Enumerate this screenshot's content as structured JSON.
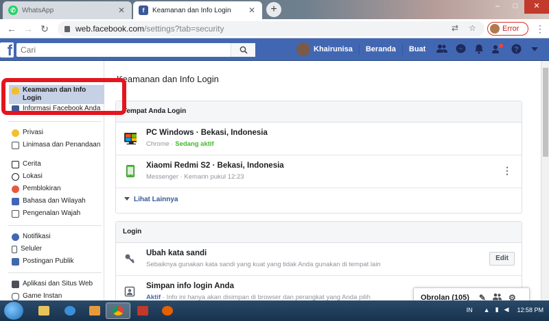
{
  "browser": {
    "tabs": [
      {
        "label": "WhatsApp",
        "active": false
      },
      {
        "label": "Keamanan dan Info Login",
        "active": true
      }
    ],
    "url_host": "web.facebook.com",
    "url_path": "/settings?tab=security",
    "profile_button": "Error"
  },
  "fb_header": {
    "search_placeholder": "Cari",
    "user_name": "Khairunisa",
    "home_label": "Beranda",
    "create_label": "Buat"
  },
  "left_nav": {
    "group1": [
      {
        "label": "Keamanan dan Info Login",
        "selected": true
      },
      {
        "label": "Informasi Facebook Anda",
        "selected": false
      }
    ],
    "group2": [
      {
        "label": "Privasi"
      },
      {
        "label": "Linimasa dan Penandaan"
      },
      {
        "label": "Cerita"
      },
      {
        "label": "Lokasi"
      },
      {
        "label": "Pemblokiran"
      },
      {
        "label": "Bahasa dan Wilayah"
      },
      {
        "label": "Pengenalan Wajah"
      }
    ],
    "group3": [
      {
        "label": "Notifikasi"
      },
      {
        "label": "Seluler"
      },
      {
        "label": "Postingan Publik"
      }
    ],
    "group4": [
      {
        "label": "Aplikasi dan Situs Web"
      },
      {
        "label": "Game Instan"
      }
    ]
  },
  "main": {
    "title": "Keamanan dan Info Login",
    "where_logged_in": {
      "header": "Tempat Anda Login",
      "sessions": [
        {
          "device": "PC Windows · Bekasi, Indonesia",
          "app": "Chrome · ",
          "status": "Sedang aktif"
        },
        {
          "device": "Xiaomi Redmi S2 · Bekasi, Indonesia",
          "app": "Messenger · Kemarin pukul 12:23",
          "status": ""
        }
      ],
      "see_more": "Lihat Lainnya"
    },
    "login": {
      "header": "Login",
      "change_password": {
        "title": "Ubah kata sandi",
        "desc": "Sebaiknya gunakan kata sandi yang kuat yang tidak Anda gunakan di tempat lain",
        "button": "Edit"
      },
      "save_login": {
        "title": "Simpan info login Anda",
        "status": "Aktif",
        "desc": " · Info ini hanya akan disimpan di browser dan perangkat yang Anda pilih"
      }
    }
  },
  "chat": {
    "label": "Obrolan (105)"
  },
  "taskbar": {
    "lang": "IN",
    "time": "12:58 PM"
  }
}
